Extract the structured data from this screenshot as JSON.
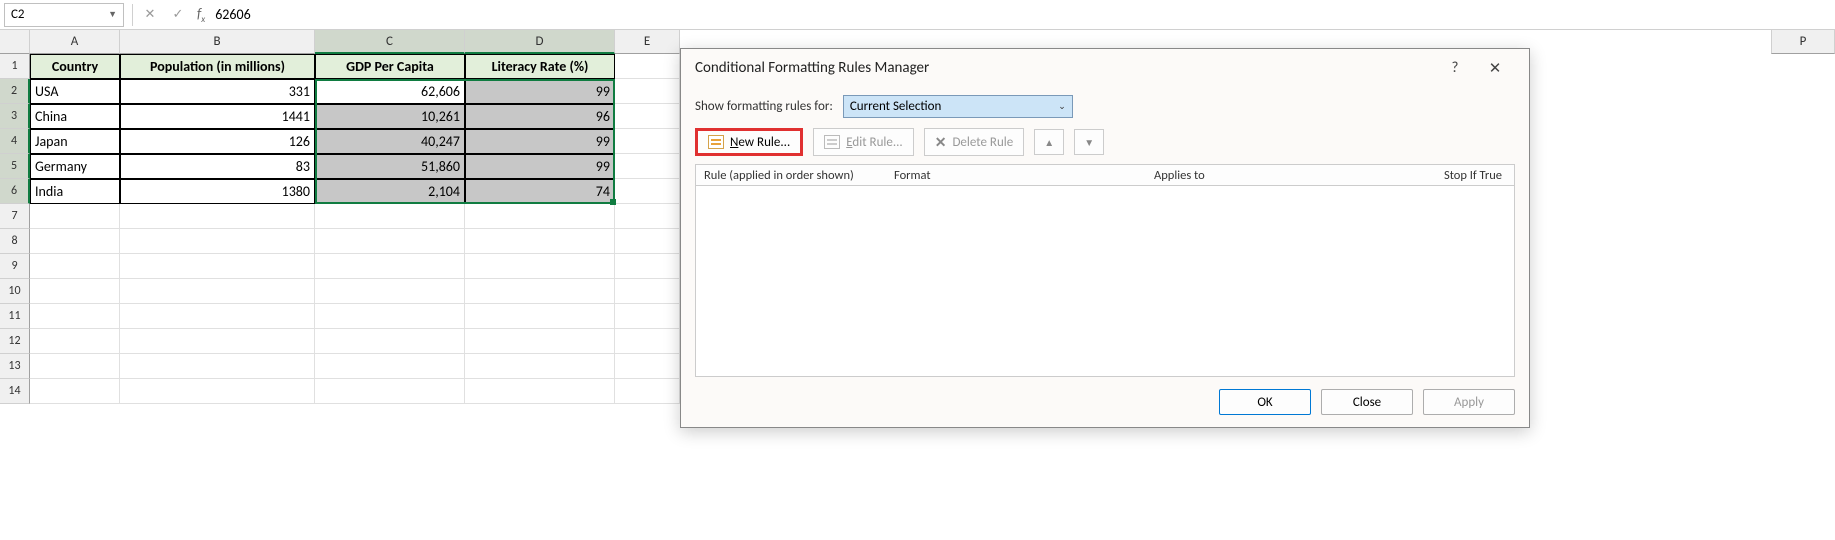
{
  "formula_bar": {
    "name_box": "C2",
    "formula_value": "62606"
  },
  "columns": [
    "A",
    "B",
    "C",
    "D",
    "E"
  ],
  "col_P": "P",
  "row_numbers": [
    "1",
    "2",
    "3",
    "4",
    "5",
    "6",
    "7",
    "8",
    "9",
    "10",
    "11",
    "12",
    "13",
    "14"
  ],
  "headers": {
    "country": "Country",
    "population": "Population (in millions)",
    "gdp": "GDP Per Capita",
    "literacy": "Literacy Rate (%)"
  },
  "data": [
    {
      "country": "USA",
      "population": "331",
      "gdp": "62,606",
      "literacy": "99"
    },
    {
      "country": "China",
      "population": "1441",
      "gdp": "10,261",
      "literacy": "96"
    },
    {
      "country": "Japan",
      "population": "126",
      "gdp": "40,247",
      "literacy": "99"
    },
    {
      "country": "Germany",
      "population": "83",
      "gdp": "51,860",
      "literacy": "99"
    },
    {
      "country": "India",
      "population": "1380",
      "gdp": "2,104",
      "literacy": "74"
    }
  ],
  "dialog": {
    "title": "Conditional Formatting Rules Manager",
    "help": "?",
    "close": "✕",
    "show_label": "Show formatting rules for:",
    "show_value": "Current Selection",
    "new_rule": "New Rule...",
    "edit_rule": "Edit Rule...",
    "delete_rule": "Delete Rule",
    "col_rule": "Rule (applied in order shown)",
    "col_format": "Format",
    "col_applies": "Applies to",
    "col_stop": "Stop If True",
    "ok": "OK",
    "close_btn": "Close",
    "apply": "Apply"
  }
}
